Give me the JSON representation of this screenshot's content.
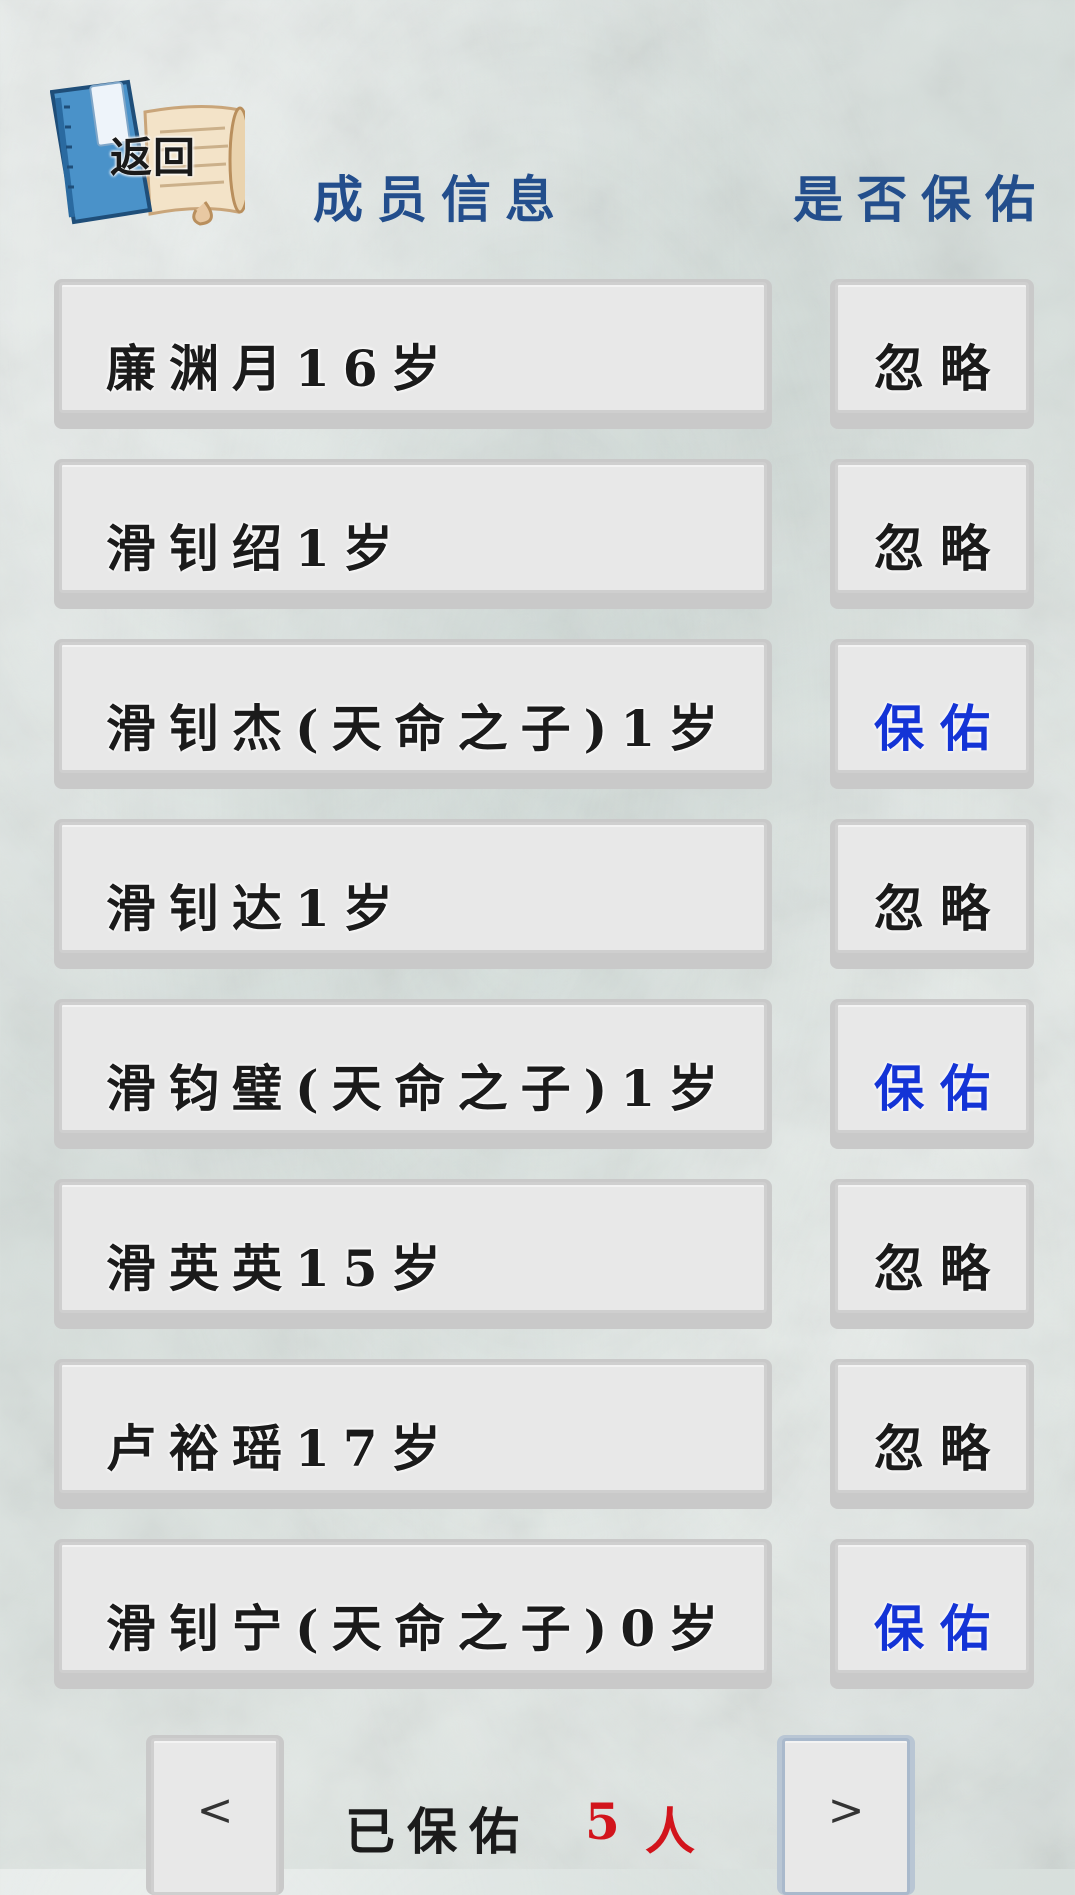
{
  "header": {
    "back_label": "返回",
    "member_info_title": "成员信息",
    "protect_title": "是否保佑"
  },
  "members": [
    {
      "name": "廉渊月16岁",
      "status": "忽略"
    },
    {
      "name": "滑钊绍1岁",
      "status": "忽略"
    },
    {
      "name": "滑钊杰(天命之子)1岁",
      "status": "保佑"
    },
    {
      "name": "滑钊达1岁",
      "status": "忽略"
    },
    {
      "name": "滑钧璧(天命之子)1岁",
      "status": "保佑"
    },
    {
      "name": "滑英英15岁",
      "status": "忽略"
    },
    {
      "name": "卢裕瑶17岁",
      "status": "忽略"
    },
    {
      "name": "滑钊宁(天命之子)0岁",
      "status": "保佑"
    }
  ],
  "footer": {
    "prev_glyph": "<",
    "next_glyph": ">",
    "protected_label": "已保佑",
    "protected_count": "5",
    "protected_unit": "人"
  },
  "colors": {
    "header_text": "#234e8c",
    "protect_status": "#1434d6",
    "ignore_status": "#1b1b1b",
    "count_highlight": "#d2141c"
  },
  "icons": {
    "back": "book-scroll-icon"
  }
}
